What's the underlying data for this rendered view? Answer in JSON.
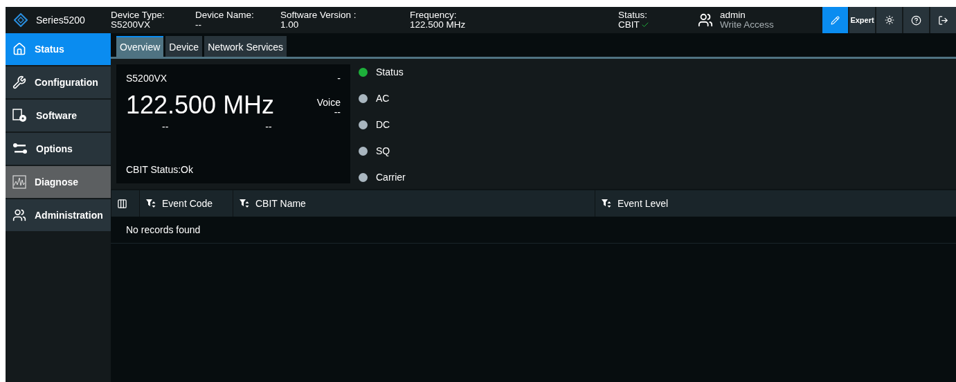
{
  "header": {
    "brand": "Series5200",
    "fields": [
      {
        "label": "Device Type:",
        "value": "S5200VX"
      },
      {
        "label": "Device Name:",
        "value": "--"
      },
      {
        "label": "Software Version :",
        "value": "1.00"
      },
      {
        "label": "Frequency:",
        "value": "122.500 MHz"
      }
    ],
    "status": {
      "label": "Status:",
      "value": "CBIT",
      "ok": true
    },
    "user": {
      "name": "admin",
      "access": "Write Access"
    },
    "buttons": [
      {
        "kind": "edit",
        "selected": true
      },
      {
        "kind": "text",
        "label": "Expert",
        "selected": false
      },
      {
        "kind": "theme",
        "selected": false
      },
      {
        "kind": "help",
        "selected": false
      },
      {
        "kind": "logout",
        "selected": false
      }
    ]
  },
  "sidebar": {
    "items": [
      {
        "kind": "home",
        "label": "Status",
        "selected": true,
        "highlighted": false
      },
      {
        "kind": "wrench",
        "label": "Configuration",
        "selected": false,
        "highlighted": false
      },
      {
        "kind": "software",
        "label": "Software",
        "selected": false,
        "highlighted": false
      },
      {
        "kind": "keys",
        "label": "Options",
        "selected": false,
        "highlighted": false
      },
      {
        "kind": "chart",
        "label": "Diagnose",
        "selected": false,
        "highlighted": true
      },
      {
        "kind": "users",
        "label": "Administration",
        "selected": false,
        "highlighted": false
      }
    ]
  },
  "tabs": [
    {
      "label": "Overview",
      "selected": true
    },
    {
      "label": "Device",
      "selected": false
    },
    {
      "label": "Network Services",
      "selected": false
    }
  ],
  "device_card": {
    "model": "S5200VX",
    "corner": "-",
    "frequency": "122.500 MHz",
    "mode_label": "Voice",
    "mode_value": "--",
    "sub_values": [
      "--",
      "--"
    ],
    "cbit": "CBIT Status:Ok"
  },
  "indicators": [
    {
      "label": "Status",
      "color": "#1db03a"
    },
    {
      "label": "AC",
      "color": "#a9b6bf"
    },
    {
      "label": "DC",
      "color": "#a9b6bf"
    },
    {
      "label": "SQ",
      "color": "#a9b6bf"
    },
    {
      "label": "Carrier",
      "color": "#a9b6bf"
    }
  ],
  "table": {
    "columns": [
      "Event Code",
      "CBIT Name",
      "Event Level"
    ],
    "empty_message": "No records found"
  }
}
